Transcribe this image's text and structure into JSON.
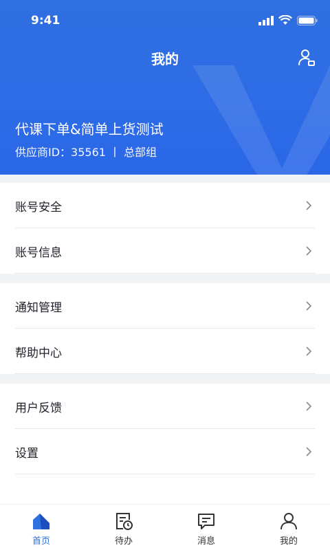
{
  "status": {
    "time": "9:41"
  },
  "header": {
    "title": "我的",
    "company": "代课下单&简单上货测试",
    "supplier": "供应商ID：35561 丨 总部组"
  },
  "menu": {
    "group1": [
      {
        "label": "账号安全"
      },
      {
        "label": "账号信息"
      }
    ],
    "group2": [
      {
        "label": "通知管理"
      },
      {
        "label": "帮助中心"
      }
    ],
    "group3": [
      {
        "label": "用户反馈"
      },
      {
        "label": "设置"
      }
    ]
  },
  "tabs": [
    {
      "label": "首页",
      "icon": "home-icon",
      "active": true
    },
    {
      "label": "待办",
      "icon": "todo-icon",
      "active": false
    },
    {
      "label": "消息",
      "icon": "message-icon",
      "active": false
    },
    {
      "label": "我的",
      "icon": "user-icon",
      "active": false
    }
  ],
  "colors": {
    "accent": "#2f6fe0",
    "text": "#1f2329",
    "background": "#f2f3f5"
  }
}
